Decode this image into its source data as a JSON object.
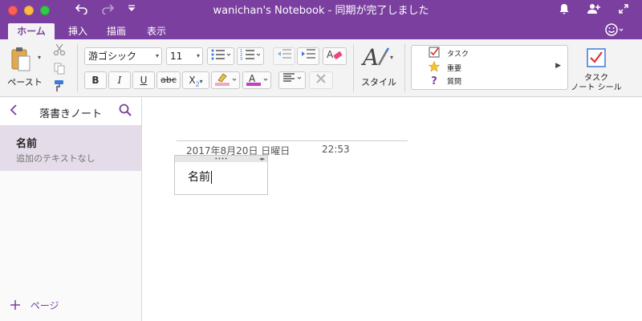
{
  "window": {
    "title": "wanichan's Notebook - 同期が完了しました"
  },
  "tabs": [
    {
      "label": "ホーム",
      "active": true
    },
    {
      "label": "挿入",
      "active": false
    },
    {
      "label": "描画",
      "active": false
    },
    {
      "label": "表示",
      "active": false
    }
  ],
  "ribbon": {
    "paste_label": "ペースト",
    "font_name": "游ゴシック",
    "font_size": "11",
    "bold": "B",
    "italic": "I",
    "underline": "U",
    "strike": "abc",
    "subscript": "X",
    "subscript_mark": "2",
    "font_color_glyph": "A",
    "style_label": "スタイル",
    "tags": [
      {
        "label": "タスク",
        "icon": "checkbox-icon"
      },
      {
        "label": "重要",
        "icon": "star-icon"
      },
      {
        "label": "質問",
        "icon": "question-icon"
      }
    ],
    "task_tag_label_line1": "タスク",
    "task_tag_label_line2": "ノート シール"
  },
  "sidebar": {
    "title": "落書きノート",
    "pages": [
      {
        "title": "名前",
        "subtitle": "追加のテキストなし"
      }
    ],
    "add_page_label": "ページ"
  },
  "note": {
    "date": "2017年8月20日 日曜日",
    "time": "22:53",
    "text": "名前"
  },
  "colors": {
    "accent": "#7b3fa0",
    "selected_page": "#e4dce9",
    "highlight": "#f0a8c8",
    "font_color": "#c23fc2"
  }
}
